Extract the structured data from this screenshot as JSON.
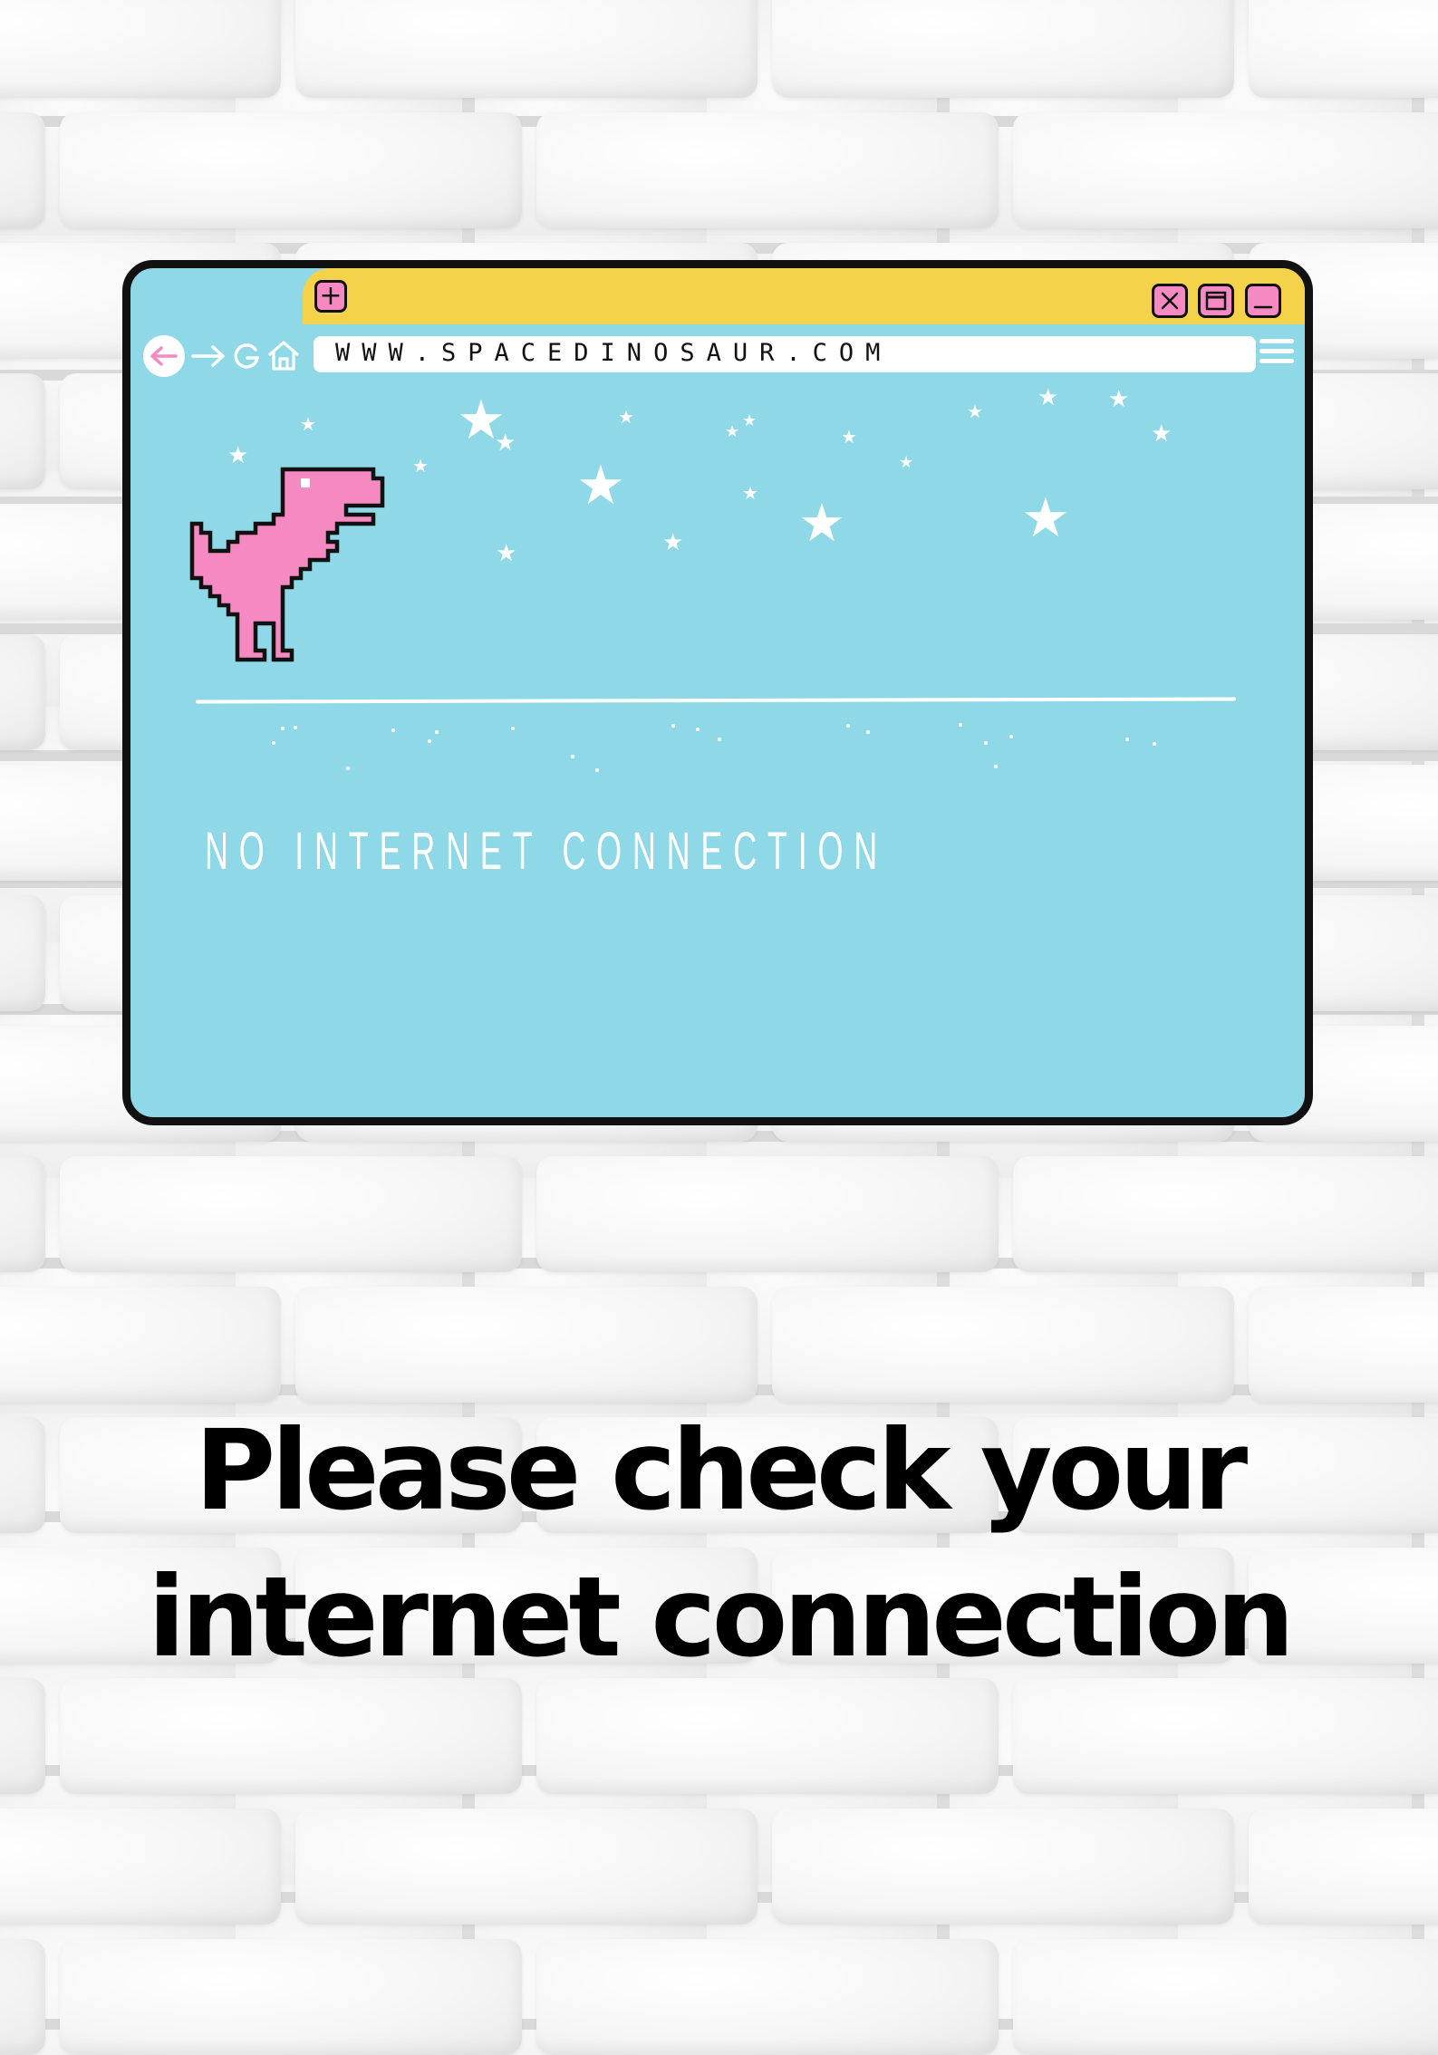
{
  "browser": {
    "tab_add_glyph": "+",
    "url": "WWW.SPACEDINOSAUR.COM",
    "message": "NO INTERNET CONNECTION",
    "icons": [
      "back-arrow-icon",
      "forward-arrow-icon",
      "refresh-icon",
      "home-icon",
      "menu-icon",
      "close-icon",
      "maximize-icon",
      "minimize-icon"
    ]
  },
  "poster": {
    "line1": "Please check your",
    "line2": "internet connection"
  },
  "colors": {
    "window_bg": "#8ed8e8",
    "tab_bar": "#f4d34b",
    "accent_pink": "#f58ac3",
    "outline": "#111111"
  }
}
